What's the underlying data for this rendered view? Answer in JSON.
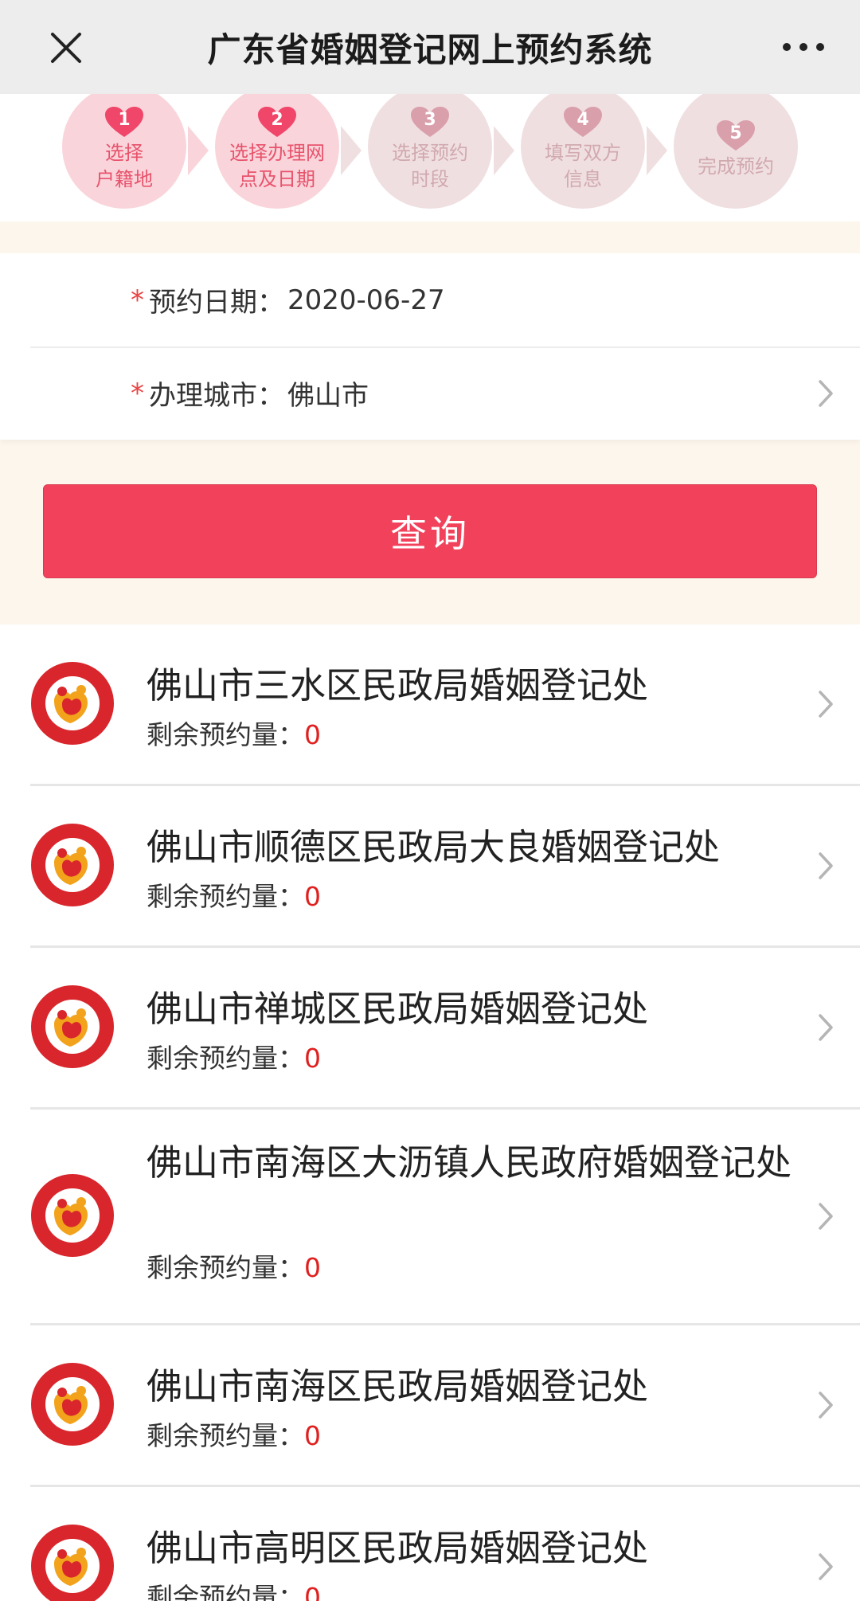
{
  "nav": {
    "title": "广东省婚姻登记网上预约系统",
    "close_icon": "close-icon",
    "more_icon": "more-icon"
  },
  "steps": [
    {
      "num": "1",
      "label": "选择\n户籍地",
      "state": "active"
    },
    {
      "num": "2",
      "label": "选择办理网\n点及日期",
      "state": "active"
    },
    {
      "num": "3",
      "label": "选择预约\n时段",
      "state": "inactive"
    },
    {
      "num": "4",
      "label": "填写双方\n信息",
      "state": "inactive"
    },
    {
      "num": "5",
      "label": "完成预约",
      "state": "inactive"
    }
  ],
  "form": {
    "required_mark": "*",
    "date_label": "预约日期：",
    "date_value": "2020-06-27",
    "city_label": "办理城市：",
    "city_value": "佛山市"
  },
  "query_button": "查询",
  "quota_label": "剩余预约量：",
  "offices": [
    {
      "name": "佛山市三水区民政局婚姻登记处",
      "quota": "0"
    },
    {
      "name": "佛山市顺德区民政局大良婚姻登记处",
      "quota": "0"
    },
    {
      "name": "佛山市禅城区民政局婚姻登记处",
      "quota": "0"
    },
    {
      "name": "佛山市南海区大沥镇人民政府婚姻登记处",
      "quota": "0"
    },
    {
      "name": "佛山市南海区民政局婚姻登记处",
      "quota": "0"
    },
    {
      "name": "佛山市高明区民政局婚姻登记处",
      "quota": "0"
    }
  ],
  "colors": {
    "accent": "#f2425b",
    "step_active": "#f9d5db",
    "step_inactive": "#f0dfe1",
    "quota_number": "#e02020",
    "beige_bg": "#fdf6ec"
  }
}
